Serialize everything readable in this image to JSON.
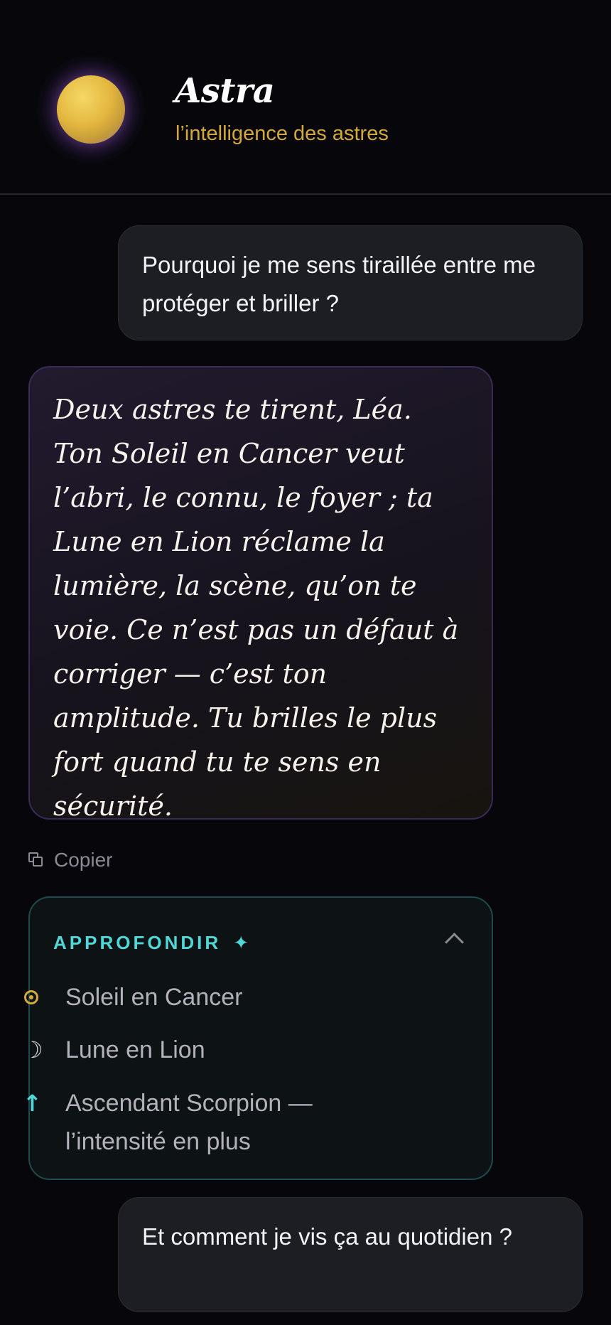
{
  "header": {
    "title": "Astra",
    "subtitle": "l’intelligence des astres",
    "avatar_icon": "golden-orb"
  },
  "messages": [
    {
      "role": "user",
      "text": "Pourquoi je me sens tiraillée entre me protéger et briller ?"
    },
    {
      "role": "astra",
      "text": "Deux astres te tirent, Léa. Ton Soleil en Cancer veut l’abri, le connu, le foyer ; ta Lune en Lion réclame la lumière, la scène, qu’on te voie. Ce n’est pas un défaut à corriger — c’est ton amplitude. Tu brilles le plus fort quand tu te sens en sécurité."
    },
    {
      "role": "user",
      "text": "Et comment je vis ça au quotidien ?"
    }
  ],
  "actions": {
    "copy_label": "Copier"
  },
  "approfondir": {
    "title": "APPROFONDIR",
    "title_icon": "✦",
    "items": [
      {
        "icon": "sun-icon",
        "glyph": "☉",
        "label": "Soleil en Cancer"
      },
      {
        "icon": "moon-icon",
        "glyph": "☽",
        "label": "Lune en Lion"
      },
      {
        "icon": "arrow-up-icon",
        "glyph": "↑",
        "label": "Ascendant Scorpion — l’intensité en plus"
      }
    ]
  },
  "colors": {
    "background": "#07070b",
    "accent_gold": "#d4a93c",
    "accent_teal": "#4fd8d8",
    "user_bubble": "#1d1d24",
    "astra_border": "#3a2a55"
  }
}
